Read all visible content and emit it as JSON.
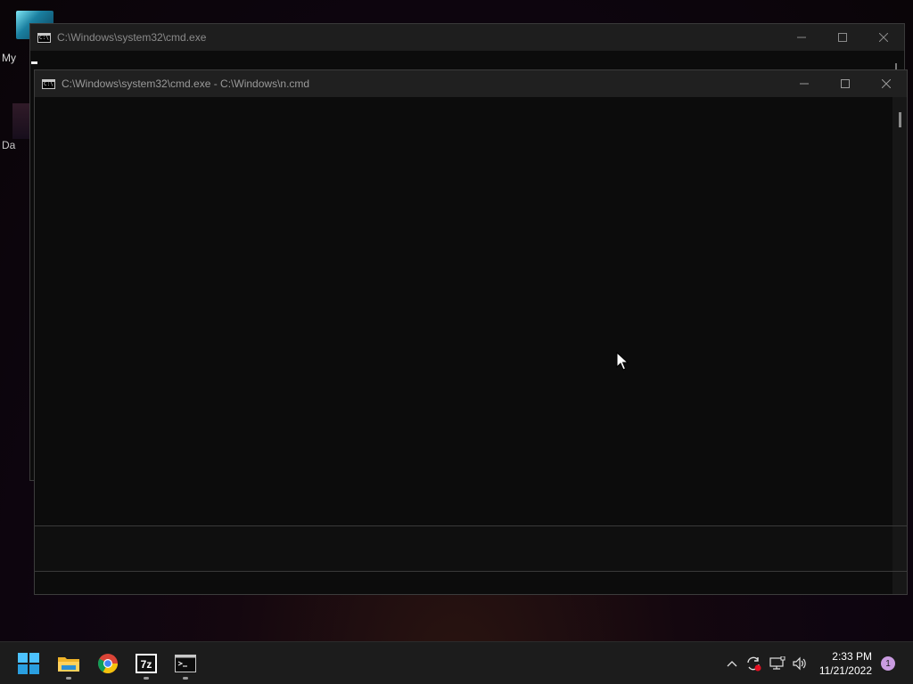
{
  "desktop": {
    "icons": [
      {
        "label": "My",
        "icon": "folder-icon"
      },
      {
        "label": "Da",
        "icon": "app-icon"
      }
    ]
  },
  "windows": [
    {
      "title": "C:\\Windows\\system32\\cmd.exe",
      "icon": "cmd-icon"
    },
    {
      "title": "C:\\Windows\\system32\\cmd.exe - C:\\Windows\\n.cmd",
      "icon": "cmd-icon"
    }
  ],
  "cmd_icon_glyph": "C:\\",
  "taskbar": {
    "apps": [
      {
        "name": "Start",
        "icon": "windows-start-icon"
      },
      {
        "name": "File Explorer",
        "icon": "file-explorer-icon"
      },
      {
        "name": "Google Chrome",
        "icon": "chrome-icon"
      },
      {
        "name": "7-Zip",
        "icon": "7zip-icon",
        "label": "7z"
      },
      {
        "name": "Command Prompt",
        "icon": "cmd-icon"
      }
    ],
    "tray": {
      "time": "2:33 PM",
      "date": "11/21/2022",
      "notification_count": "1"
    }
  },
  "colors": {
    "start_blue": "#4cc2ff",
    "notification_badge": "#c99be0"
  }
}
